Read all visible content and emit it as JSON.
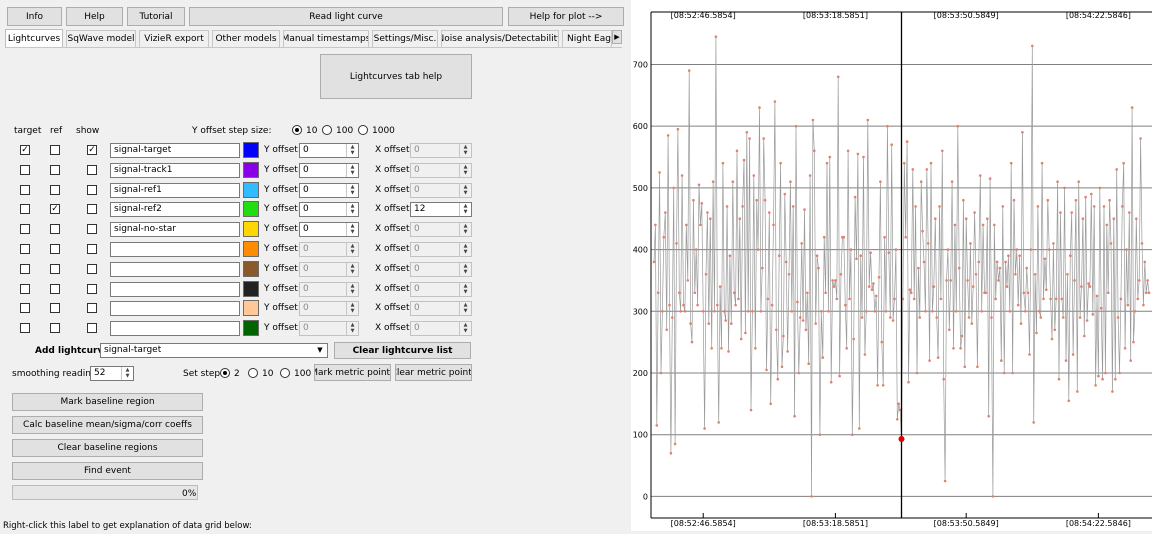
{
  "toolbar": {
    "info": "Info",
    "help": "Help",
    "tutorial": "Tutorial",
    "read_light_curve": "Read light curve",
    "help_for_plot": "Help for plot -->"
  },
  "tabs": [
    "Lightcurves",
    "SqWave model",
    "VizieR export",
    "Other models",
    "Manual timestamps",
    "Settings/Misc.",
    "Noise analysis/Detectability",
    "Night Eagl"
  ],
  "tab_scroll_right": "▶",
  "lightcurves_tab_help": "Lightcurves tab help",
  "columns": {
    "target": "target",
    "ref": "ref",
    "show": "show"
  },
  "y_offset_step": {
    "label": "Y offset step size:",
    "options": [
      "10",
      "100",
      "1000"
    ],
    "selected": "10"
  },
  "y_offset_label": "Y offset:",
  "x_offset_label": "X offset:",
  "rows": [
    {
      "target": true,
      "ref": false,
      "show": true,
      "name": "signal-target",
      "color": "#0000ff",
      "yoff": "0",
      "xoff": "0",
      "enabled": true,
      "xoff_enabled": false
    },
    {
      "target": false,
      "ref": false,
      "show": false,
      "name": "signal-track1",
      "color": "#8a00e6",
      "yoff": "0",
      "xoff": "0",
      "enabled": true,
      "xoff_enabled": false
    },
    {
      "target": false,
      "ref": false,
      "show": false,
      "name": "signal-ref1",
      "color": "#33bbff",
      "yoff": "0",
      "xoff": "0",
      "enabled": true,
      "xoff_enabled": false
    },
    {
      "target": false,
      "ref": true,
      "show": false,
      "name": "signal-ref2",
      "color": "#22dd11",
      "yoff": "0",
      "xoff": "12",
      "enabled": true,
      "xoff_enabled": true
    },
    {
      "target": false,
      "ref": false,
      "show": false,
      "name": "signal-no-star",
      "color": "#ffd700",
      "yoff": "0",
      "xoff": "0",
      "enabled": true,
      "xoff_enabled": false
    },
    {
      "target": false,
      "ref": false,
      "show": false,
      "name": "",
      "color": "#ff8c00",
      "yoff": "0",
      "xoff": "0",
      "enabled": false,
      "xoff_enabled": false
    },
    {
      "target": false,
      "ref": false,
      "show": false,
      "name": "",
      "color": "#8b5a2b",
      "yoff": "0",
      "xoff": "0",
      "enabled": false,
      "xoff_enabled": false
    },
    {
      "target": false,
      "ref": false,
      "show": false,
      "name": "",
      "color": "#222222",
      "yoff": "0",
      "xoff": "0",
      "enabled": false,
      "xoff_enabled": false
    },
    {
      "target": false,
      "ref": false,
      "show": false,
      "name": "",
      "color": "#ffc896",
      "yoff": "0",
      "xoff": "0",
      "enabled": false,
      "xoff_enabled": false
    },
    {
      "target": false,
      "ref": false,
      "show": false,
      "name": "",
      "color": "#006400",
      "yoff": "0",
      "xoff": "0",
      "enabled": false,
      "xoff_enabled": false
    }
  ],
  "add_lightcurve": {
    "label": "Add lightcurve",
    "value": "signal-target"
  },
  "clear_lightcurve_list": "Clear lightcurve list",
  "smoothing": {
    "label": "smoothing readings",
    "value": "52"
  },
  "set_step": {
    "label": "Set step:",
    "options": [
      "2",
      "10",
      "100"
    ],
    "selected": "2"
  },
  "mark_metric_points": "Mark metric points",
  "clear_metric_points": "Clear metric points",
  "mark_baseline_region": "Mark baseline region",
  "calc_baseline": "Calc baseline mean/sigma/corr coeffs",
  "clear_baseline_regions": "Clear baseline regions",
  "find_event": "Find event",
  "progress": {
    "value": 0,
    "text": "0%"
  },
  "footer_note": "Right-click this label to get explanation of data grid below:",
  "chart_data": {
    "type": "line",
    "x_tick_labels": [
      "[08:52:46.5854]",
      "[08:53:18.5851]",
      "[08:53:50.5849]",
      "[08:54:22.5846]"
    ],
    "yticks": [
      0,
      100,
      200,
      300,
      400,
      500,
      600,
      700
    ],
    "ylim": [
      -35,
      785
    ],
    "n_points": 351,
    "cursor_index": 176,
    "highlight_point": {
      "index": 176,
      "value": 93
    },
    "colors": {
      "line": "#9a9a9a",
      "point": "#e08070",
      "highlight": "#e00000",
      "cursor": "#000000",
      "grid": "#808080"
    },
    "series": [
      {
        "values": [
          380,
          440,
          115,
          330,
          525,
          200,
          300,
          420,
          460,
          270,
          585,
          310,
          70,
          290,
          500,
          85,
          410,
          595,
          330,
          300,
          520,
          310,
          300,
          440,
          350,
          690,
          280,
          250,
          480,
          330,
          400,
          310,
          505,
          440,
          475,
          300,
          110,
          360,
          460,
          280,
          450,
          240,
          510,
          300,
          745,
          310,
          120,
          340,
          240,
          540,
          300,
          285,
          470,
          235,
          390,
          280,
          510,
          330,
          310,
          560,
          320,
          450,
          255,
          470,
          545,
          265,
          590,
          300,
          580,
          140,
          300,
          520,
          240,
          480,
          400,
          630,
          300,
          370,
          580,
          480,
          205,
          320,
          460,
          150,
          310,
          440,
          640,
          270,
          190,
          390,
          540,
          210,
          260,
          490,
          380,
          235,
          360,
          510,
          300,
          470,
          130,
          600,
          315,
          200,
          290,
          410,
          285,
          465,
          270,
          330,
          215,
          520,
          0,
          610,
          560,
          280,
          390,
          370,
          100,
          300,
          225,
          420,
          330,
          540,
          300,
          550,
          185,
          350,
          340,
          350,
          320,
          680,
          195,
          360,
          420,
          420,
          310,
          240,
          560,
          320,
          400,
          100,
          255,
          485,
          385,
          555,
          110,
          390,
          290,
          550,
          230,
          300,
          610,
          340,
          395,
          335,
          345,
          300,
          325,
          180,
          355,
          510,
          250,
          180,
          420,
          300,
          600,
          395,
          290,
          570,
          285,
          320,
          400,
          125,
          150,
          140,
          93,
          320,
          540,
          420,
          575,
          185,
          335,
          330,
          530,
          320,
          470,
          200,
          370,
          290,
          510,
          430,
          380,
          300,
          530,
          410,
          220,
          540,
          300,
          340,
          450,
          290,
          225,
          470,
          320,
          560,
          190,
          25,
          350,
          400,
          270,
          350,
          510,
          240,
          440,
          300,
          600,
          370,
          240,
          260,
          480,
          210,
          450,
          350,
          290,
          410,
          280,
          340,
          460,
          360,
          210,
          380,
          520,
          300,
          440,
          330,
          330,
          450,
          130,
          515,
          290,
          0,
          440,
          320,
          380,
          350,
          370,
          220,
          470,
          200,
          380,
          340,
          390,
          300,
          540,
          200,
          480,
          360,
          400,
          310,
          390,
          280,
          590,
          330,
          300,
          370,
          330,
          230,
          400,
          730,
          120,
          360,
          265,
          470,
          300,
          290,
          540,
          320,
          385,
          335,
          480,
          400,
          320,
          255,
          410,
          270,
          320,
          510,
          190,
          460,
          320,
          290,
          500,
          220,
          360,
          155,
          390,
          460,
          230,
          350,
          480,
          170,
          510,
          290,
          340,
          450,
          260,
          485,
          285,
          345,
          340,
          490,
          295,
          470,
          180,
          325,
          195,
          500,
          305,
          190,
          470,
          200,
          440,
          330,
          480,
          410,
          170,
          450,
          190,
          530,
          290,
          200,
          320,
          470,
          540,
          240,
          400,
          310,
          460,
          220,
          630,
          250,
          300,
          450,
          320,
          350,
          580,
          410,
          310,
          380,
          330,
          350,
          330
        ]
      }
    ]
  }
}
